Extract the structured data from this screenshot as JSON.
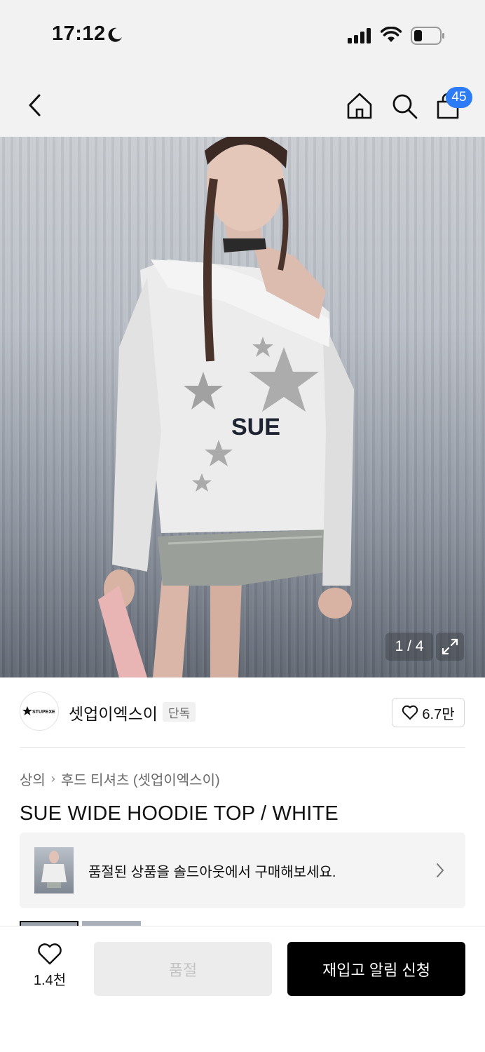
{
  "status": {
    "time": "17:12",
    "icons": [
      "moon-icon",
      "signal-icon",
      "wifi-icon",
      "battery-icon"
    ]
  },
  "nav": {
    "icons": [
      "back-icon",
      "home-icon",
      "search-icon",
      "cart-icon"
    ],
    "cart_count": "45"
  },
  "hero": {
    "counter": "1 / 4",
    "print_text": "SUE"
  },
  "brand": {
    "logo_text": "STUPEXE",
    "name": "셋업이엑스이",
    "tag": "단독",
    "likes": "6.7만"
  },
  "breadcrumb": {
    "level1": "상의",
    "level2": "후드 티셔츠 (셋업이엑스이)"
  },
  "product": {
    "title": "SUE WIDE HOODIE TOP / WHITE"
  },
  "soldout_banner": {
    "text": "품절된 상품을 솔드아웃에서 구매해보세요."
  },
  "bottom": {
    "wish_count": "1.4천",
    "soldout_label": "품절",
    "restock_label": "재입고 알림 신청"
  },
  "colors": {
    "badge": "#2d7cf6",
    "primary_button": "#000000",
    "disabled_button": "#ececec"
  }
}
